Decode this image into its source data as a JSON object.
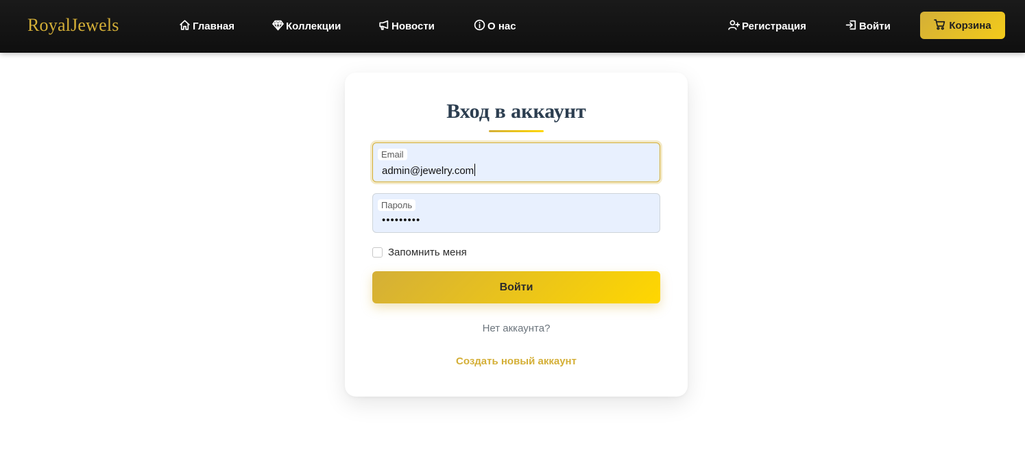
{
  "brand": "RoyalJewels",
  "nav": {
    "home": "Главная",
    "collections": "Коллекции",
    "news": "Новости",
    "about": "О нас",
    "register": "Регистрация",
    "login": "Войти",
    "cart": "Корзина"
  },
  "login_form": {
    "title": "Вход в аккаунт",
    "email_label": "Email",
    "email_value": "admin@jewelry.com",
    "password_label": "Пароль",
    "password_value": "•••••••••",
    "remember_label": "Запомнить меня",
    "remember_checked": false,
    "submit_label": "Войти",
    "no_account_text": "Нет аккаунта?",
    "create_account_link": "Создать новый аккаунт"
  },
  "colors": {
    "accent": "#d4af37",
    "accent_light": "#ffd700",
    "nav_bg": "#111111",
    "title_text": "#2c3e50",
    "input_bg": "#e8f0fe"
  },
  "icons": {
    "home": "home-icon",
    "collections": "gem-icon",
    "news": "megaphone-icon",
    "about": "info-icon",
    "register": "person-plus-icon",
    "login": "box-arrow-in-right-icon",
    "cart": "cart-icon"
  }
}
